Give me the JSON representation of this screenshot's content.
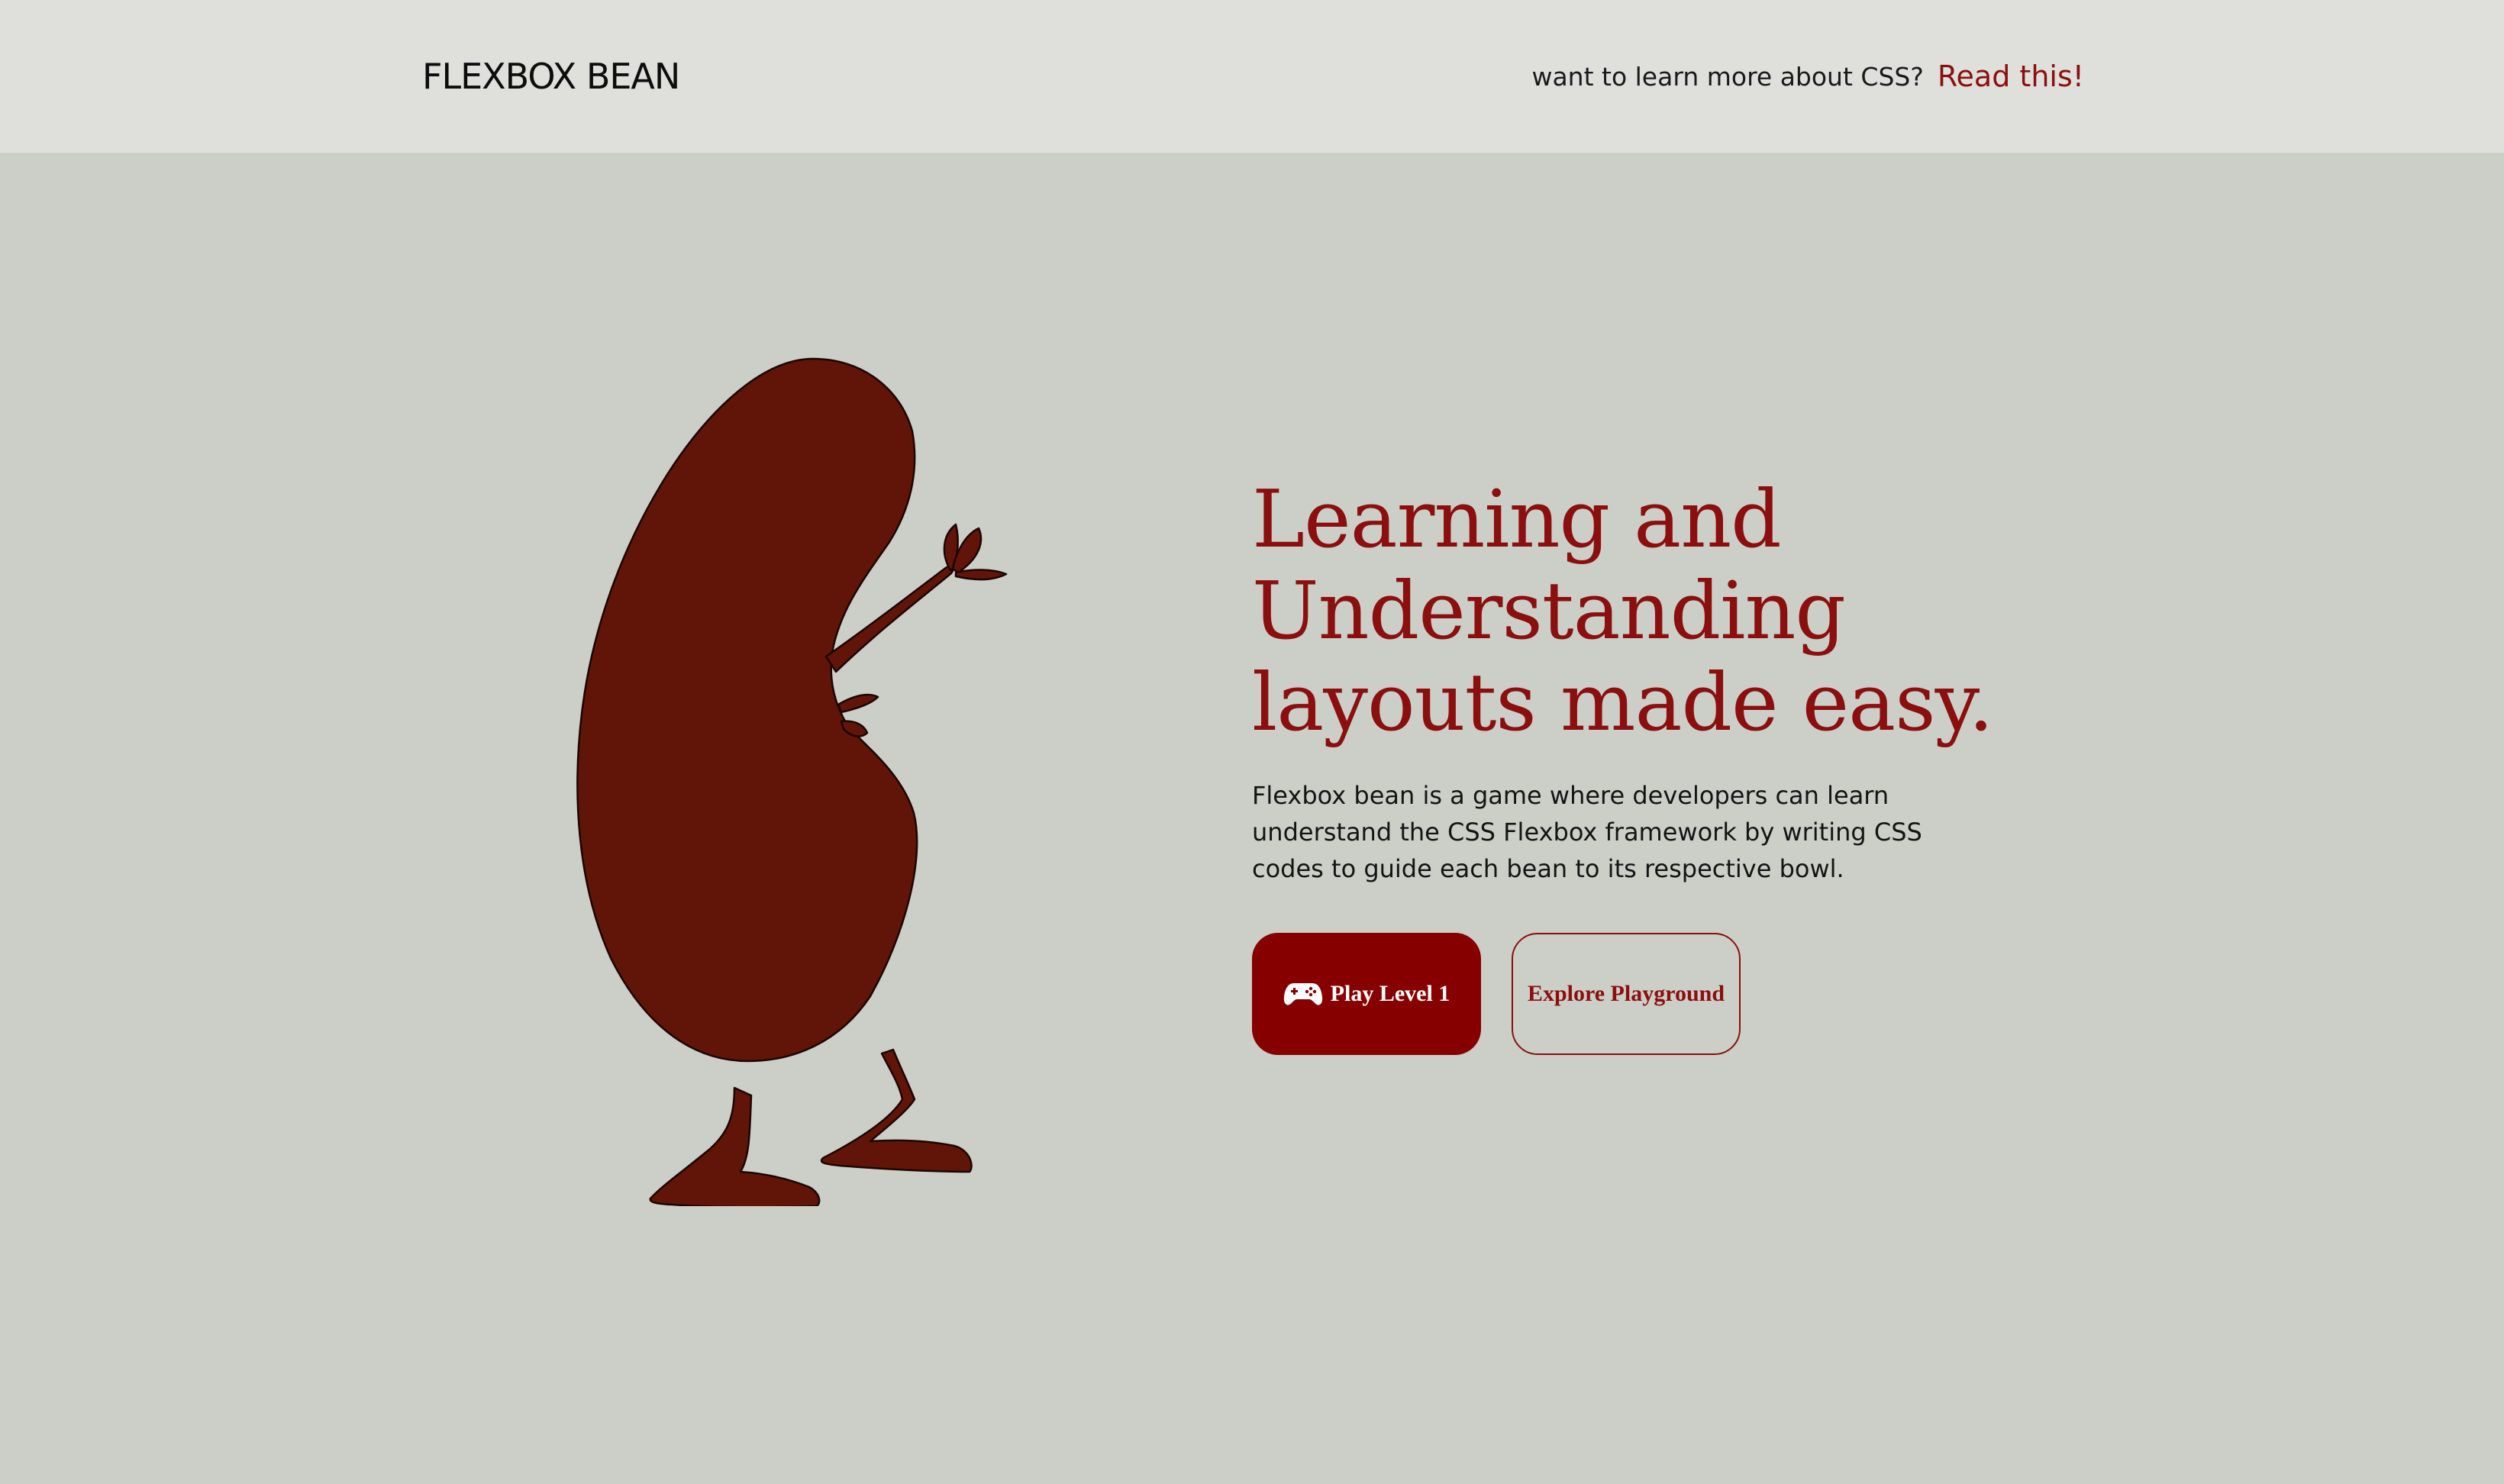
{
  "header": {
    "brand": "FLEXBOX BEAN",
    "question": "want to learn more about CSS?",
    "link_label": "Read this!"
  },
  "hero": {
    "title_line1": "Learning and",
    "title_line2": "Understanding",
    "title_line3": "layouts made easy.",
    "description": "Flexbox bean is a game where developers can learn understand the CSS Flexbox framework by writing CSS codes to guide each bean to its respective bowl.",
    "play_button": "Play Level 1",
    "play_icon": "gamepad-icon",
    "explore_button": "Explore Playground"
  },
  "colors": {
    "accent": "#870000",
    "bean": "#611508",
    "page_bg": "#cccfc8",
    "header_bg": "#dfe0db"
  }
}
